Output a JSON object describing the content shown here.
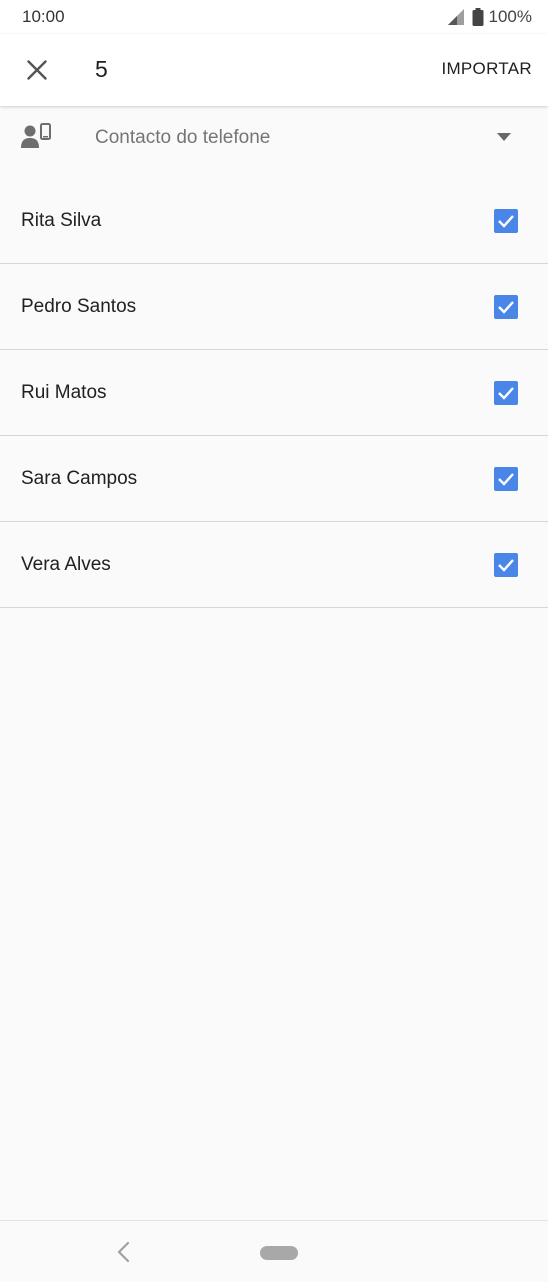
{
  "status_bar": {
    "time": "10:00",
    "battery_text": "100%",
    "icons": [
      "signal-icon",
      "battery-icon"
    ]
  },
  "app_bar": {
    "close_icon": "close-icon",
    "selected_count": "5",
    "import_label": "IMPORTAR"
  },
  "account_selector": {
    "icon": "phone-contact-icon",
    "label": "Contacto do telefone",
    "dropdown_icon": "dropdown-arrow-icon"
  },
  "contacts": [
    {
      "name": "Rita Silva",
      "checked": true
    },
    {
      "name": "Pedro Santos",
      "checked": true
    },
    {
      "name": "Rui Matos",
      "checked": true
    },
    {
      "name": "Sara Campos",
      "checked": true
    },
    {
      "name": "Vera Alves",
      "checked": true
    }
  ],
  "colors": {
    "checkbox": "#4a86e8",
    "background": "#fafafa",
    "app_bar": "#ffffff"
  },
  "nav_bar": {
    "back_icon": "back-chevron-icon",
    "home_icon": "home-pill-icon"
  }
}
